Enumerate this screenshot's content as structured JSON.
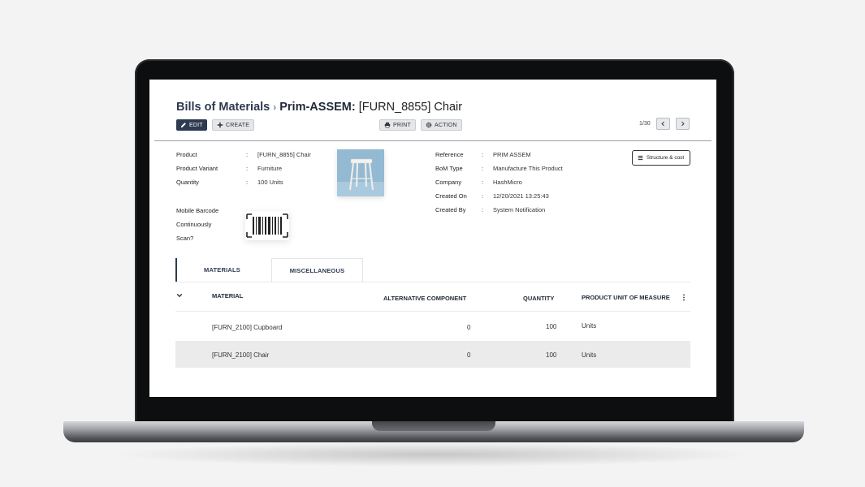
{
  "header": {
    "breadcrumb_root": "Bills of Materials",
    "breadcrumb_sep": "›",
    "record_prefix": "Prim-ASSEM:",
    "record_name": "[FURN_8855] Chair"
  },
  "toolbar": {
    "edit_label": "EDIT",
    "create_label": "CREATE",
    "print_label": "PRINT",
    "action_label": "ACTION",
    "pager": "1/30"
  },
  "left_fields": [
    {
      "label": "Product",
      "value": "[FURN_8855] Chair"
    },
    {
      "label": "Product Variant",
      "value": "Furniture"
    },
    {
      "label": "Quantity",
      "value": "100 Units"
    }
  ],
  "barcode": {
    "label_line1": "Mobile Barcode",
    "label_line2": "Continuously",
    "label_line3": "Scan?"
  },
  "right_fields": [
    {
      "label": "Reference",
      "value": "PRIM ASSEM"
    },
    {
      "label": "BoM Type",
      "value": "Manufacture This Product"
    },
    {
      "label": "Company",
      "value": "HashMicro"
    },
    {
      "label": "Created On",
      "value": "12/20/2021 13:25:43"
    },
    {
      "label": "Created By",
      "value": "System Notification"
    }
  ],
  "colon": ":",
  "structure_button": "Structure & cost",
  "tabs": [
    {
      "label": "MATERIALS",
      "active": true
    },
    {
      "label": "MISCELLANEOUS",
      "active": false
    }
  ],
  "table": {
    "headers": {
      "material": "MATERIAL",
      "alternative": "ALTERNATIVE COMPONENT",
      "quantity": "QUANTITY",
      "uom": "PRODUCT UNIT  OF MEASURE"
    },
    "rows": [
      {
        "material": "[FURN_2100] Cupboard",
        "alternative": "0",
        "quantity": "100",
        "uom": "Units"
      },
      {
        "material": "[FURN_2100] Chair",
        "alternative": "0",
        "quantity": "100",
        "uom": "Units"
      }
    ]
  },
  "colors": {
    "primary": "#2d3a4f",
    "row_highlight": "#ebebeb",
    "product_image_bg": "#93b9d3"
  }
}
